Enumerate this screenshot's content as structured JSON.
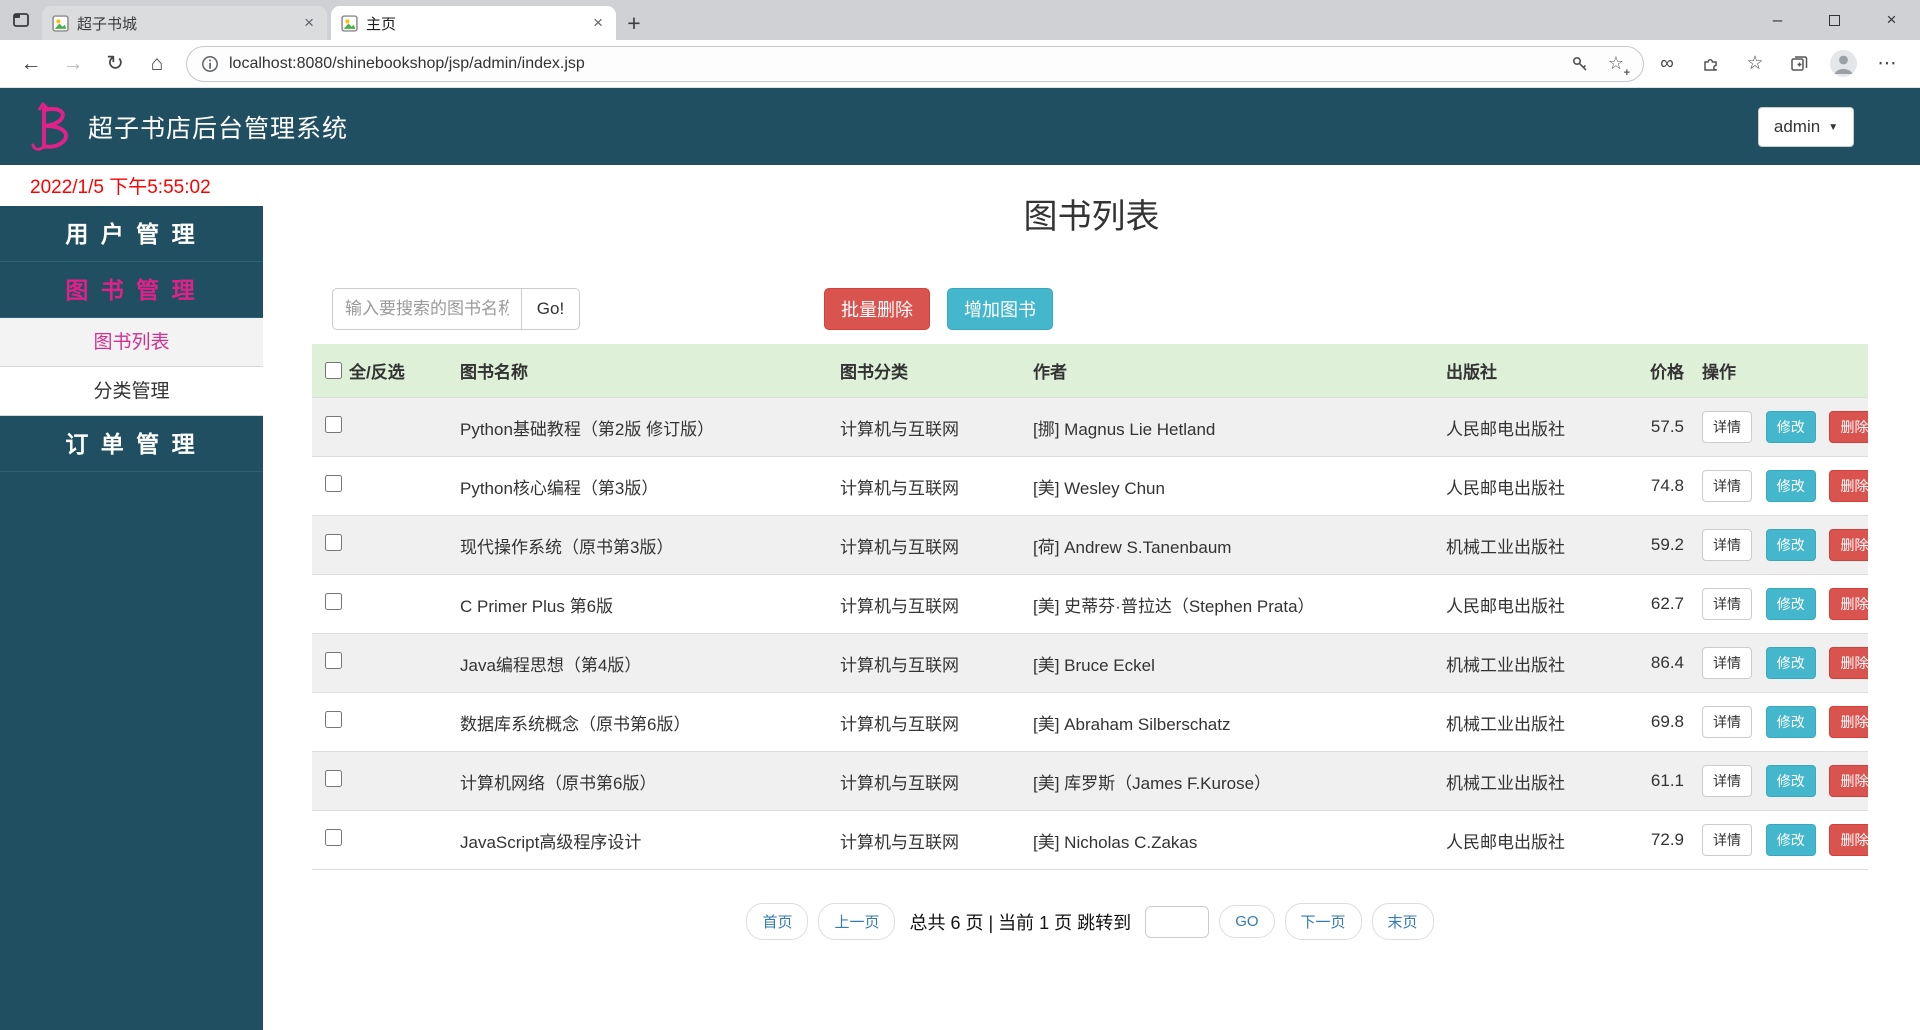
{
  "browser": {
    "tabs": [
      {
        "title": "超子书城"
      },
      {
        "title": "主页"
      }
    ],
    "url": "localhost:8080/shinebookshop/jsp/admin/index.jsp"
  },
  "icons": {
    "back": "←",
    "forward": "→",
    "refresh": "↻",
    "home": "⌂",
    "infinity": "∞",
    "favorites": "☆",
    "more": "⋯",
    "new_tab": "+",
    "minimize": "–",
    "close": "×",
    "tab_close": "×",
    "caret_down": "▼",
    "star_add": "☆",
    "plus_badge": "+"
  },
  "header": {
    "title": "超子书店后台管理系统",
    "user_menu": "admin"
  },
  "timestamp": "2022/1/5 下午5:55:02",
  "sidebar": {
    "items": [
      {
        "label": "用 户 管 理"
      },
      {
        "label": "图 书 管 理"
      },
      {
        "label": "图书列表"
      },
      {
        "label": "分类管理"
      },
      {
        "label": "订 单 管 理"
      }
    ]
  },
  "main": {
    "title": "图书列表",
    "search_placeholder": "输入要搜索的图书名称",
    "search_button": "Go!",
    "batch_delete": "批量删除",
    "add_book": "增加图书",
    "table": {
      "headers": [
        "全/反选",
        "图书名称",
        "图书分类",
        "作者",
        "出版社",
        "价格",
        "操作"
      ],
      "action_labels": {
        "detail": "详情",
        "edit": "修改",
        "delete": "删除"
      },
      "rows": [
        {
          "name": "Python基础教程（第2版 修订版）",
          "category": "计算机与互联网",
          "author": "[挪] Magnus Lie Hetland",
          "publisher": "人民邮电出版社",
          "price": "57.5"
        },
        {
          "name": "Python核心编程（第3版）",
          "category": "计算机与互联网",
          "author": "[美] Wesley Chun",
          "publisher": "人民邮电出版社",
          "price": "74.8"
        },
        {
          "name": "现代操作系统（原书第3版）",
          "category": "计算机与互联网",
          "author": "[荷] Andrew S.Tanenbaum",
          "publisher": "机械工业出版社",
          "price": "59.2"
        },
        {
          "name": "C Primer Plus 第6版",
          "category": "计算机与互联网",
          "author": "[美] 史蒂芬·普拉达（Stephen Prata）",
          "publisher": "人民邮电出版社",
          "price": "62.7"
        },
        {
          "name": "Java编程思想（第4版）",
          "category": "计算机与互联网",
          "author": "[美] Bruce Eckel",
          "publisher": "机械工业出版社",
          "price": "86.4"
        },
        {
          "name": "数据库系统概念（原书第6版）",
          "category": "计算机与互联网",
          "author": "[美] Abraham Silberschatz",
          "publisher": "机械工业出版社",
          "price": "69.8"
        },
        {
          "name": "计算机网络（原书第6版）",
          "category": "计算机与互联网",
          "author": "[美] 库罗斯（James F.Kurose）",
          "publisher": "机械工业出版社",
          "price": "61.1"
        },
        {
          "name": "JavaScript高级程序设计",
          "category": "计算机与互联网",
          "author": "[美] Nicholas C.Zakas",
          "publisher": "人民邮电出版社",
          "price": "72.9"
        }
      ]
    },
    "pagination": {
      "first": "首页",
      "prev": "上一页",
      "info": "总共 6 页 | 当前 1 页 跳转到",
      "go_label": "GO",
      "next": "下一页",
      "last": "末页"
    }
  },
  "colors": {
    "header_teal": "#1f4f61",
    "accent_pink": "#e0218a",
    "danger_red": "#d9534f",
    "info_cyan": "#45b7cd",
    "table_header_green": "#dff0d8",
    "timestamp_red": "#ff0000",
    "pagination_link_blue": "#337ab7"
  }
}
